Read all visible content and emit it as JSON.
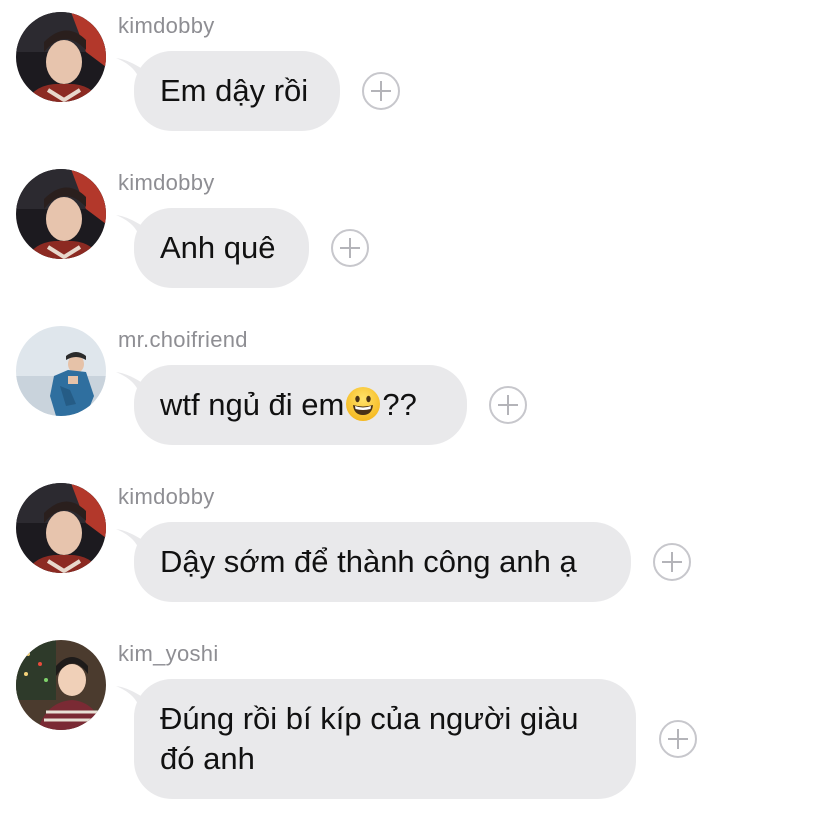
{
  "messages": [
    {
      "username": "kimdobby",
      "text": "Em dậy rồi",
      "avatar": "avatar-kimdobby"
    },
    {
      "username": "kimdobby",
      "text": "Anh quê",
      "avatar": "avatar-kimdobby"
    },
    {
      "username": "mr.choifriend",
      "text_before": "wtf ngủ đi em",
      "emoji": "grinning-face-emoji",
      "text_after": "??",
      "avatar": "avatar-mr-choifriend"
    },
    {
      "username": "kimdobby",
      "text": "Dậy sớm để thành công anh ạ",
      "avatar": "avatar-kimdobby"
    },
    {
      "username": "kim_yoshi",
      "text_line1": "Đúng rồi bí kíp của người giàu",
      "text_line2": "đó anh",
      "avatar": "avatar-kim-yoshi"
    }
  ],
  "colors": {
    "bubble": "#e9e9eb",
    "username": "#8e8e93",
    "text": "#111111",
    "plus_border": "#c7c7cc"
  }
}
